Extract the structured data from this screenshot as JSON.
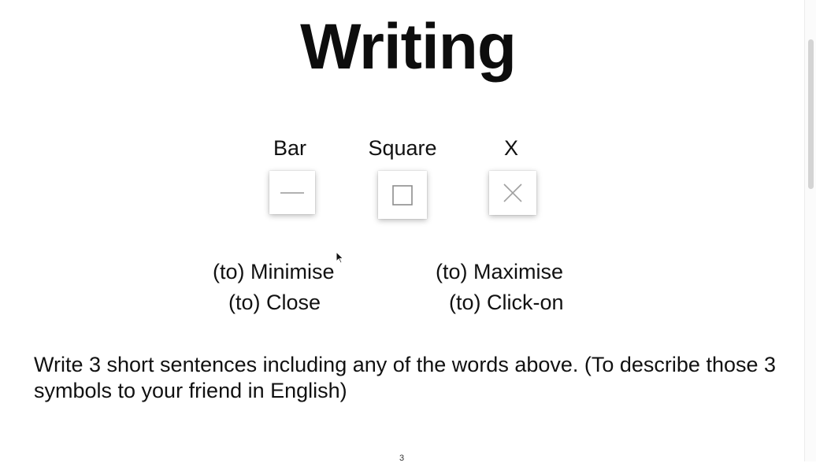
{
  "title": "Writing",
  "symbols": [
    {
      "label": "Bar",
      "icon": "minus-icon"
    },
    {
      "label": "Square",
      "icon": "square-icon"
    },
    {
      "label": "X",
      "icon": "x-icon"
    }
  ],
  "verbs": {
    "minimise": "(to) Minimise",
    "maximise": "(to) Maximise",
    "close": "(to) Close",
    "click_on": "(to) Click-on"
  },
  "instruction": "Write 3 short sentences including any of the words above. (To describe those 3 symbols to your friend in English)",
  "page_number": "3",
  "colors": {
    "text": "#111111",
    "icon_stroke": "#999999"
  }
}
